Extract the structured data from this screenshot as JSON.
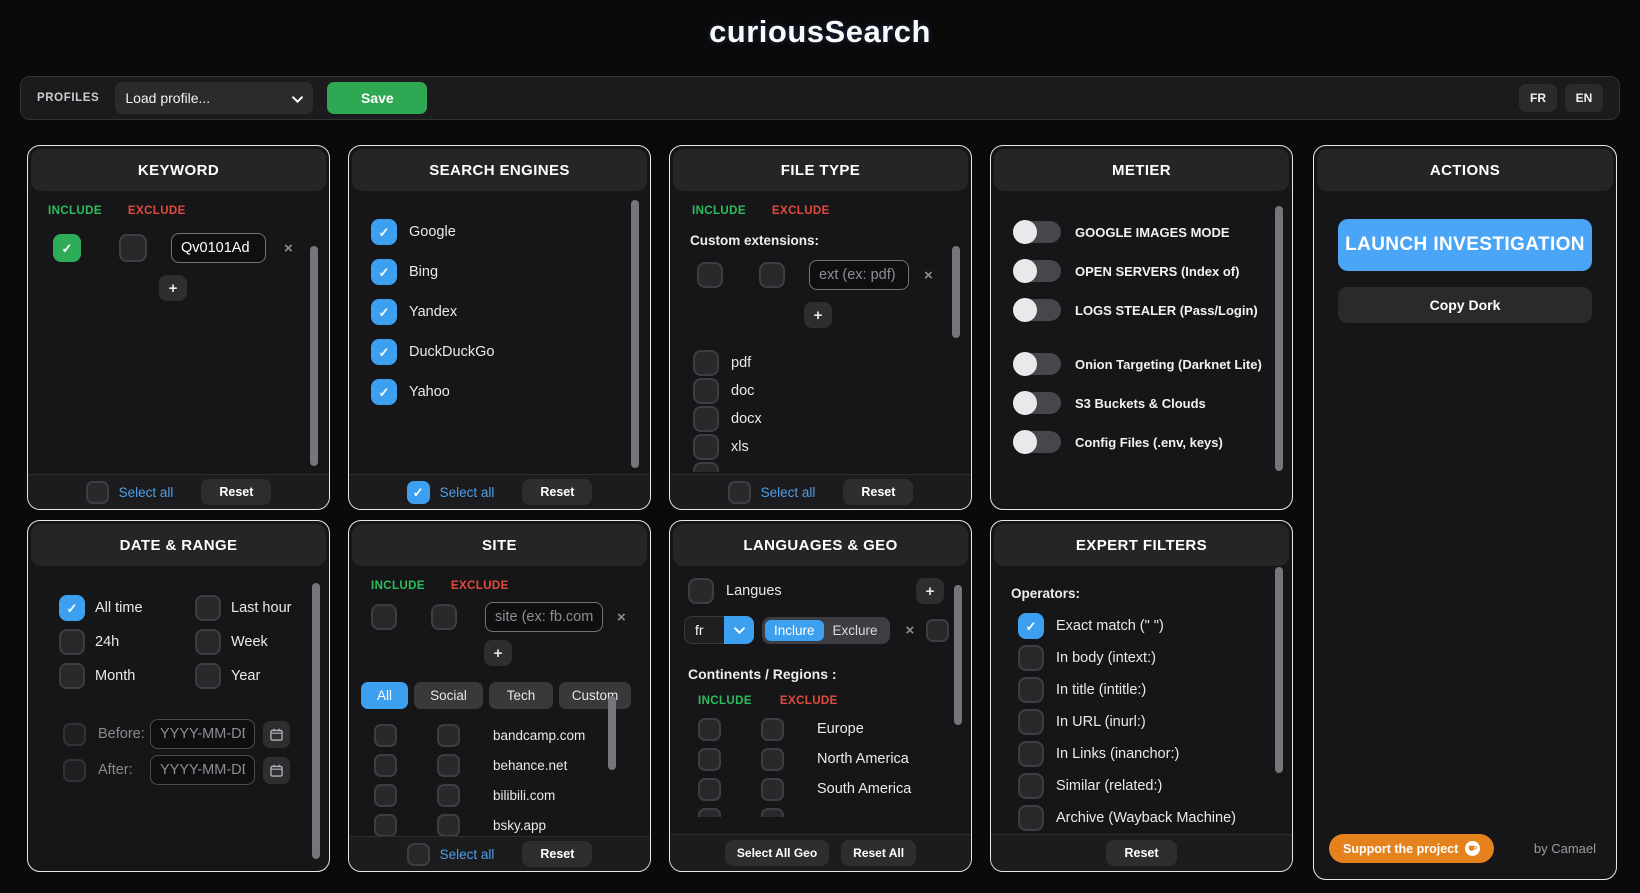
{
  "icons": {
    "check": "✓",
    "close": "×",
    "plus": "+"
  },
  "colors": {
    "accent_blue": "#3d9ff0",
    "green": "#2eab57",
    "save_green": "#2fa853",
    "red": "#e2483d",
    "orange": "#e5821d",
    "panel_bg": "#161618",
    "page_bg": "#0a0a0b"
  },
  "title": "curiousSearch",
  "topbar": {
    "profiles_label": "PROFILES",
    "load_profile": "Load profile...",
    "save": "Save",
    "fr": "FR",
    "en": "EN"
  },
  "keyword": {
    "title": "KEYWORD",
    "include": "INCLUDE",
    "exclude": "EXCLUDE",
    "value": "Qv0101Ad",
    "select_all": "Select all",
    "reset": "Reset"
  },
  "engines": {
    "title": "SEARCH ENGINES",
    "items": [
      {
        "label": "Google",
        "checked": true
      },
      {
        "label": "Bing",
        "checked": true
      },
      {
        "label": "Yandex",
        "checked": true
      },
      {
        "label": "DuckDuckGo",
        "checked": true
      },
      {
        "label": "Yahoo",
        "checked": true
      }
    ],
    "select_all": "Select all",
    "reset": "Reset"
  },
  "filetype": {
    "title": "FILE TYPE",
    "include": "INCLUDE",
    "exclude": "EXCLUDE",
    "custom_label": "Custom extensions:",
    "placeholder": "ext (ex: pdf)",
    "types": [
      {
        "label": "pdf",
        "checked": false
      },
      {
        "label": "doc",
        "checked": false
      },
      {
        "label": "docx",
        "checked": false
      },
      {
        "label": "xls",
        "checked": false
      }
    ],
    "select_all": "Select all",
    "reset": "Reset"
  },
  "metier": {
    "title": "METIER",
    "group1": [
      {
        "label": "GOOGLE IMAGES MODE",
        "on": false
      },
      {
        "label": "OPEN SERVERS (Index of)",
        "on": false
      },
      {
        "label": "LOGS STEALER (Pass/Login)",
        "on": false
      }
    ],
    "group2": [
      {
        "label": "Onion Targeting (Darknet Lite)",
        "on": false
      },
      {
        "label": "S3 Buckets & Clouds",
        "on": false
      },
      {
        "label": "Config Files (.env, keys)",
        "on": false
      }
    ]
  },
  "actions": {
    "title": "ACTIONS",
    "launch": "LAUNCH INVESTIGATION",
    "copy": "Copy Dork",
    "support": "Support the project",
    "credit": "by Camael"
  },
  "date": {
    "title": "DATE & RANGE",
    "options": [
      {
        "label": "All time",
        "checked": true
      },
      {
        "label": "Last hour",
        "checked": false
      },
      {
        "label": "24h",
        "checked": false
      },
      {
        "label": "Week",
        "checked": false
      },
      {
        "label": "Month",
        "checked": false
      },
      {
        "label": "Year",
        "checked": false
      }
    ],
    "before": "Before:",
    "after": "After:",
    "date_placeholder": "YYYY-MM-DD"
  },
  "site": {
    "title": "SITE",
    "include": "INCLUDE",
    "exclude": "EXCLUDE",
    "placeholder": "site (ex: fb.com)",
    "tabs": [
      {
        "label": "All",
        "active": true
      },
      {
        "label": "Social",
        "active": false
      },
      {
        "label": "Tech",
        "active": false
      },
      {
        "label": "Custom",
        "active": false
      }
    ],
    "sites": [
      "bandcamp.com",
      "behance.net",
      "bilibili.com",
      "bsky.app"
    ],
    "select_all": "Select all",
    "reset": "Reset"
  },
  "langgeo": {
    "title": "LANGUAGES & GEO",
    "langues": "Langues",
    "lang_value": "fr",
    "inclure": "Inclure",
    "exclure": "Exclure",
    "continents_label": "Continents / Regions :",
    "include": "INCLUDE",
    "exclude": "EXCLUDE",
    "regions": [
      "Europe",
      "North America",
      "South America"
    ],
    "select_all_geo": "Select All Geo",
    "reset_all": "Reset All"
  },
  "expert": {
    "title": "EXPERT FILTERS",
    "operators_label": "Operators:",
    "filters": [
      {
        "label": "Exact match (\" \")",
        "checked": true
      },
      {
        "label": "In body (intext:)",
        "checked": false
      },
      {
        "label": "In title (intitle:)",
        "checked": false
      },
      {
        "label": "In URL (inurl:)",
        "checked": false
      },
      {
        "label": "In Links (inanchor:)",
        "checked": false
      },
      {
        "label": "Similar (related:)",
        "checked": false
      },
      {
        "label": "Archive (Wayback Machine)",
        "checked": false
      }
    ],
    "reset": "Reset"
  }
}
